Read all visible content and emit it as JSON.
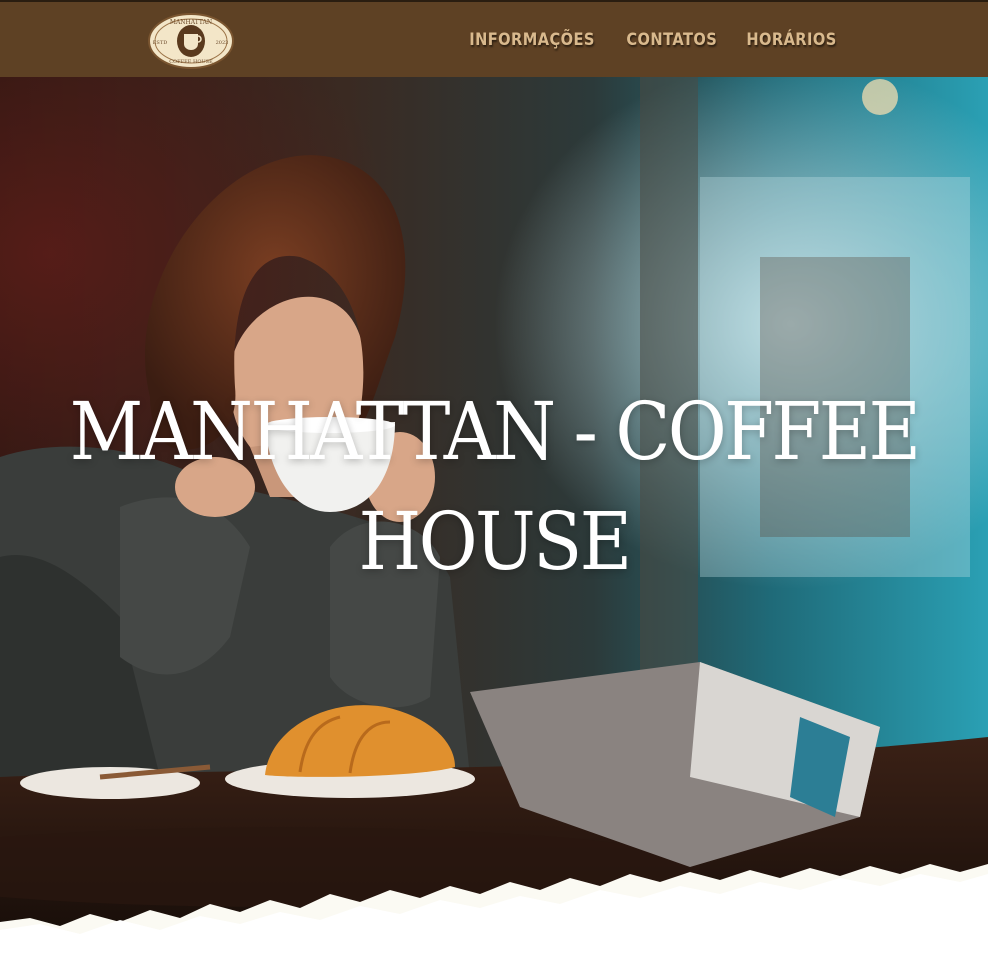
{
  "header": {
    "logo": {
      "icon": "coffee-cup-emblem",
      "text_top": "MANHATTAN",
      "text_left": "ESTD",
      "text_right": "2023",
      "text_bottom": "COFFEE HOUSE"
    },
    "nav": [
      {
        "label": "INFORMAÇÕES"
      },
      {
        "label": "CONTATOS"
      },
      {
        "label": "HORÁRIOS"
      }
    ]
  },
  "hero": {
    "title_line1": "MANHATTAN - COFFEE",
    "title_line2": "HOUSE",
    "image": "woman-drinking-coffee-photo"
  },
  "colors": {
    "header_bg": "#5e4124",
    "nav_text": "#d9b98d",
    "title": "#ffffff",
    "torn_edge": "#fbfaf3"
  }
}
